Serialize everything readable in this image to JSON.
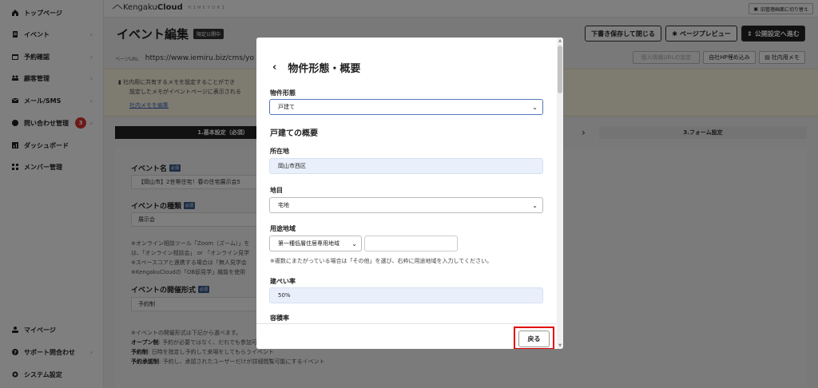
{
  "sidebar": {
    "items": [
      {
        "label": "トップページ",
        "icon": "home-icon"
      },
      {
        "label": "イベント",
        "icon": "document-icon"
      },
      {
        "label": "予約確認",
        "icon": "calendar-icon"
      },
      {
        "label": "顧客管理",
        "icon": "people-icon"
      },
      {
        "label": "メール/SMS",
        "icon": "mail-icon"
      },
      {
        "label": "問い合わせ管理",
        "icon": "chat-icon",
        "badge": "3"
      },
      {
        "label": "ダッシュボード",
        "icon": "chart-icon"
      },
      {
        "label": "メンバー管理",
        "icon": "grid-icon"
      }
    ],
    "bottom_items": [
      {
        "label": "マイページ",
        "icon": "user-icon"
      },
      {
        "label": "サポート問合わせ",
        "icon": "help-icon"
      },
      {
        "label": "システム設定",
        "icon": "gear-icon"
      }
    ]
  },
  "topbar": {
    "logo_prefix": "Kengaku",
    "logo_bold": "Cloud",
    "logo_sub": "ＨＩＭＥＹＯＲＩ",
    "switch_label": "旧管理画面に切り替え"
  },
  "page": {
    "title": "イベント編集",
    "status": "限定公開中",
    "buttons": {
      "save_close": "下書き保存して閉じる",
      "preview": "ページプレビュー",
      "publish": "公開設定へ進む"
    },
    "url_label": "ページURL",
    "url_value": "https://www.iemiru.biz/cms/yo",
    "url_buttons": [
      "個人情報URLの設定",
      "自社HP埋め込み",
      "社内用メモ"
    ],
    "memo_line1": "社内用に共有するメモを設定することができ",
    "memo_line2": "設定したメモがイベントページに表示される",
    "memo_link": "社内メモを編集",
    "steps": {
      "step1": "1.基本設定（必須）",
      "step3": "3.フォーム設定"
    },
    "form": {
      "event_name_label": "イベント名",
      "event_name_value": "【岡山市】2世帯住宅！春の住宅展示会5",
      "event_type_label": "イベントの種類",
      "event_type_value": "展示会",
      "required": "必須",
      "notes": [
        "※オンライン相談ツール「Zoom（ズーム）」を",
        "は、「オンライン相談会」 or 「オンライン見学",
        "※スペースコアと連携する場合は「無人見学会",
        "※KengakuCloudの「OB邸見学」機能を使用"
      ],
      "format_label": "イベントの開催形式",
      "format_value": "予約制",
      "format_note": "※イベントの開催形式は下記から選べます。",
      "format_items": [
        {
          "name": "オープン制",
          "desc": ": 予約が必要ではなく、だれでも参加可能なイベント"
        },
        {
          "name": "予約制",
          "desc": ": 日時を指定し予約して来場をしてもらうイベント"
        },
        {
          "name": "予約承認制",
          "desc": ": 予約し、承認されたユーザーだけが詳細閲覧可能にするイベント"
        }
      ]
    }
  },
  "modal": {
    "title": "物件形態・概要",
    "property_type_label": "物件形態",
    "property_type_value": "戸建て",
    "section_title": "戸建ての概要",
    "location_label": "所在地",
    "location_value": "岡山市西区",
    "land_label": "地目",
    "land_value": "宅地",
    "zoning_label": "用途地域",
    "zoning_value": "第一種低層住居専用地域",
    "zoning_help": "※複数にまたがっている場合は「その他」を選び、右枠に用途地域を入力してください。",
    "coverage_label": "建ぺい率",
    "coverage_value": "50%",
    "far_label": "容積率",
    "back_button": "戻る"
  }
}
